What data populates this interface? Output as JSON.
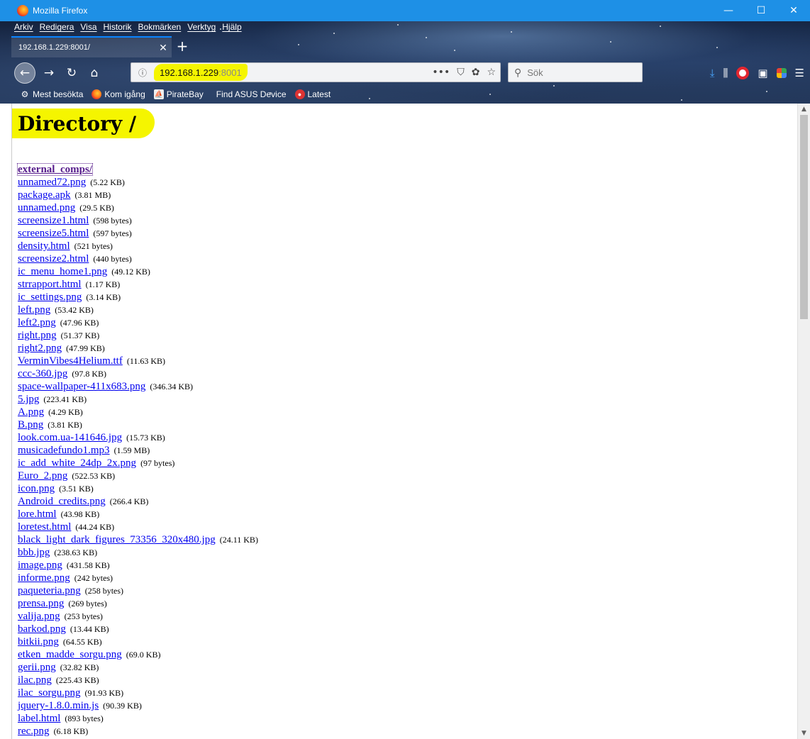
{
  "window": {
    "title": "Mozilla Firefox",
    "controls": {
      "minimize": "—",
      "maximize": "☐",
      "close": "✕"
    }
  },
  "menu": [
    "Arkiv",
    "Redigera",
    "Visa",
    "Historik",
    "Bokmärken",
    "Verktyg",
    "Hjälp"
  ],
  "tab": {
    "title": "192.168.1.229:8001/",
    "close": "✕",
    "new_tab": "+"
  },
  "urlbar": {
    "host": "192.168.1.229",
    "port": ":8001"
  },
  "searchbar": {
    "placeholder": "Sök"
  },
  "bookmarks": [
    "Mest besökta",
    "Kom igång",
    "PirateBay",
    "Find ASUS Device",
    "Latest"
  ],
  "page": {
    "heading": "Directory /",
    "entries": [
      {
        "name": "external_comps/",
        "size": ""
      },
      {
        "name": "unnamed72.png",
        "size": "(5.22 KB)"
      },
      {
        "name": "package.apk",
        "size": "(3.81 MB)"
      },
      {
        "name": "unnamed.png",
        "size": "(29.5 KB)"
      },
      {
        "name": "screensize1.html",
        "size": "(598 bytes)"
      },
      {
        "name": "screensize5.html",
        "size": "(597 bytes)"
      },
      {
        "name": "density.html",
        "size": "(521 bytes)"
      },
      {
        "name": "screensize2.html",
        "size": "(440 bytes)"
      },
      {
        "name": "ic_menu_home1.png",
        "size": "(49.12 KB)"
      },
      {
        "name": "strrapport.html",
        "size": "(1.17 KB)"
      },
      {
        "name": "ic_settings.png",
        "size": "(3.14 KB)"
      },
      {
        "name": "left.png",
        "size": "(53.42 KB)"
      },
      {
        "name": "left2.png",
        "size": "(47.96 KB)"
      },
      {
        "name": "right.png",
        "size": "(51.37 KB)"
      },
      {
        "name": "right2.png",
        "size": "(47.99 KB)"
      },
      {
        "name": "VerminVibes4Helium.ttf",
        "size": "(11.63 KB)"
      },
      {
        "name": "ccc-360.jpg",
        "size": "(97.8 KB)"
      },
      {
        "name": "space-wallpaper-411x683.png",
        "size": "(346.34 KB)"
      },
      {
        "name": "5.jpg",
        "size": "(223.41 KB)"
      },
      {
        "name": "A.png",
        "size": "(4.29 KB)"
      },
      {
        "name": "B.png",
        "size": "(3.81 KB)"
      },
      {
        "name": "look.com.ua-141646.jpg",
        "size": "(15.73 KB)"
      },
      {
        "name": "musicadefundo1.mp3",
        "size": "(1.59 MB)"
      },
      {
        "name": "ic_add_white_24dp_2x.png",
        "size": "(97 bytes)"
      },
      {
        "name": "Euro_2.png",
        "size": "(522.53 KB)"
      },
      {
        "name": "icon.png",
        "size": "(3.51 KB)"
      },
      {
        "name": "Android_credits.png",
        "size": "(266.4 KB)"
      },
      {
        "name": "lore.html",
        "size": "(43.98 KB)"
      },
      {
        "name": "loretest.html",
        "size": "(44.24 KB)"
      },
      {
        "name": "black_light_dark_figures_73356_320x480.jpg",
        "size": "(24.11 KB)"
      },
      {
        "name": "bbb.jpg",
        "size": "(238.63 KB)"
      },
      {
        "name": "image.png",
        "size": "(431.58 KB)"
      },
      {
        "name": "informe.png",
        "size": "(242 bytes)"
      },
      {
        "name": "paqueteria.png",
        "size": "(258 bytes)"
      },
      {
        "name": "prensa.png",
        "size": "(269 bytes)"
      },
      {
        "name": "valija.png",
        "size": "(253 bytes)"
      },
      {
        "name": "barkod.png",
        "size": "(13.44 KB)"
      },
      {
        "name": "bitkii.png",
        "size": "(64.55 KB)"
      },
      {
        "name": "etken_madde_sorgu.png",
        "size": "(69.0 KB)"
      },
      {
        "name": "gerii.png",
        "size": "(32.82 KB)"
      },
      {
        "name": "ilac.png",
        "size": "(225.43 KB)"
      },
      {
        "name": "ilac_sorgu.png",
        "size": "(91.93 KB)"
      },
      {
        "name": "jquery-1.8.0.min.js",
        "size": "(90.39 KB)"
      },
      {
        "name": "label.html",
        "size": "(893 bytes)"
      },
      {
        "name": "rec.png",
        "size": "(6.18 KB)"
      }
    ]
  }
}
